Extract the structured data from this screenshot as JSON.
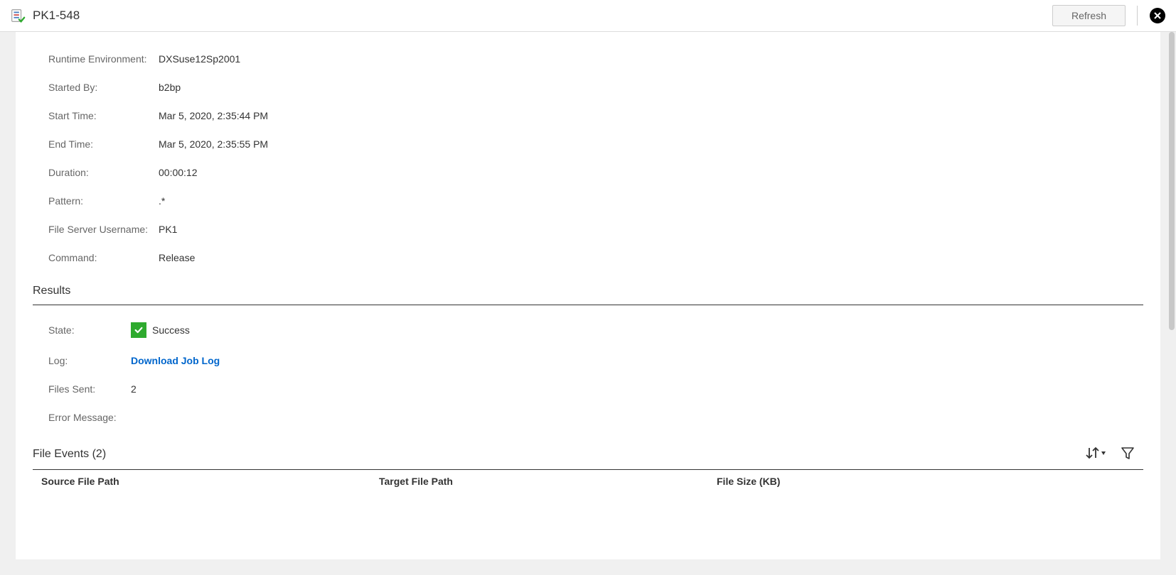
{
  "header": {
    "title": "PK1-548",
    "refresh_label": "Refresh"
  },
  "details": {
    "runtime_env_label": "Runtime Environment:",
    "runtime_env_value": "DXSuse12Sp2001",
    "started_by_label": "Started By:",
    "started_by_value": "b2bp",
    "start_time_label": "Start Time:",
    "start_time_value": "Mar 5, 2020, 2:35:44 PM",
    "end_time_label": "End Time:",
    "end_time_value": "Mar 5, 2020, 2:35:55 PM",
    "duration_label": "Duration:",
    "duration_value": "00:00:12",
    "pattern_label": "Pattern:",
    "pattern_value": ".*",
    "fs_user_label": "File Server Username:",
    "fs_user_value": "PK1",
    "command_label": "Command:",
    "command_value": "Release"
  },
  "results": {
    "heading": "Results",
    "state_label": "State:",
    "state_value": "Success",
    "log_label": "Log:",
    "log_link_text": "Download Job Log",
    "files_sent_label": "Files Sent:",
    "files_sent_value": "2",
    "error_msg_label": "Error Message:",
    "error_msg_value": ""
  },
  "file_events": {
    "heading": "File Events (2)",
    "columns": {
      "source": "Source File Path",
      "target": "Target File Path",
      "size": "File Size (KB)"
    }
  }
}
